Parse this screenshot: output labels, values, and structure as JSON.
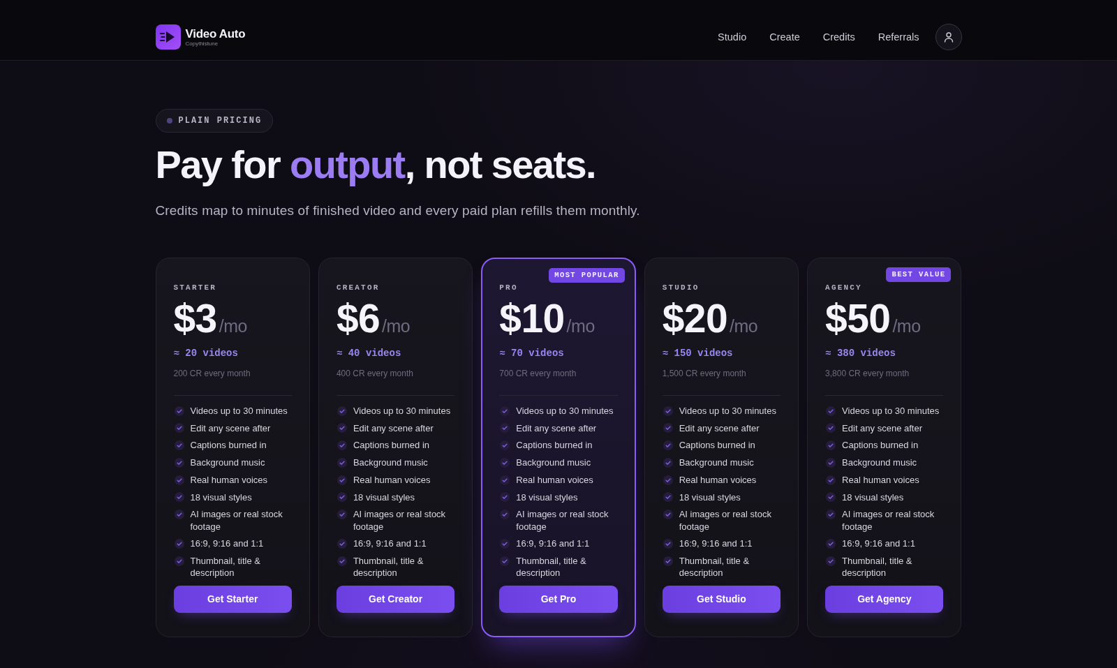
{
  "header": {
    "logo": {
      "name": "Video Auto",
      "tagline": "Copythistune"
    },
    "nav": [
      "Studio",
      "Create",
      "Credits",
      "Referrals"
    ]
  },
  "hero": {
    "eyebrow": "PLAIN PRICING",
    "title": [
      {
        "text": "Pay for ",
        "accent": false
      },
      {
        "text": "output",
        "accent": true
      },
      {
        "text": ", not seats.",
        "accent": false
      }
    ],
    "subtitle": "Credits map to minutes of finished video and every paid plan refills them monthly."
  },
  "plans": [
    {
      "name": "STARTER",
      "price": "$3",
      "period": "/mo",
      "videos": "≈ 20 videos",
      "credits": "200 CR every month",
      "features": [
        "Videos up to 30 minutes",
        "Edit any scene after",
        "Captions burned in",
        "Background music",
        "Real human voices",
        "18 visual styles",
        "AI images or real stock footage",
        "16:9, 9:16 and 1:1",
        "Thumbnail, title & description"
      ],
      "button": "Get Starter",
      "featured": false
    },
    {
      "name": "CREATOR",
      "price": "$6",
      "period": "/mo",
      "videos": "≈ 40 videos",
      "credits": "400 CR every month",
      "features": [
        "Videos up to 30 minutes",
        "Edit any scene after",
        "Captions burned in",
        "Background music",
        "Real human voices",
        "18 visual styles",
        "AI images or real stock footage",
        "16:9, 9:16 and 1:1",
        "Thumbnail, title & description"
      ],
      "button": "Get Creator",
      "featured": false
    },
    {
      "name": "PRO",
      "badge": "MOST POPULAR",
      "price": "$10",
      "period": "/mo",
      "videos": "≈ 70 videos",
      "credits": "700 CR every month",
      "features": [
        "Videos up to 30 minutes",
        "Edit any scene after",
        "Captions burned in",
        "Background music",
        "Real human voices",
        "18 visual styles",
        "AI images or real stock footage",
        "16:9, 9:16 and 1:1",
        "Thumbnail, title & description"
      ],
      "button": "Get Pro",
      "featured": true
    },
    {
      "name": "STUDIO",
      "price": "$20",
      "period": "/mo",
      "videos": "≈ 150 videos",
      "credits": "1,500 CR every month",
      "features": [
        "Videos up to 30 minutes",
        "Edit any scene after",
        "Captions burned in",
        "Background music",
        "Real human voices",
        "18 visual styles",
        "AI images or real stock footage",
        "16:9, 9:16 and 1:1",
        "Thumbnail, title & description"
      ],
      "button": "Get Studio",
      "featured": false
    },
    {
      "name": "AGENCY",
      "badge": "BEST VALUE",
      "price": "$50",
      "period": "/mo",
      "videos": "≈ 380 videos",
      "credits": "3,800 CR every month",
      "features": [
        "Videos up to 30 minutes",
        "Edit any scene after",
        "Captions burned in",
        "Background music",
        "Real human voices",
        "18 visual styles",
        "AI images or real stock footage",
        "16:9, 9:16 and 1:1",
        "Thumbnail, title & description"
      ],
      "button": "Get Agency",
      "featured": false
    }
  ]
}
